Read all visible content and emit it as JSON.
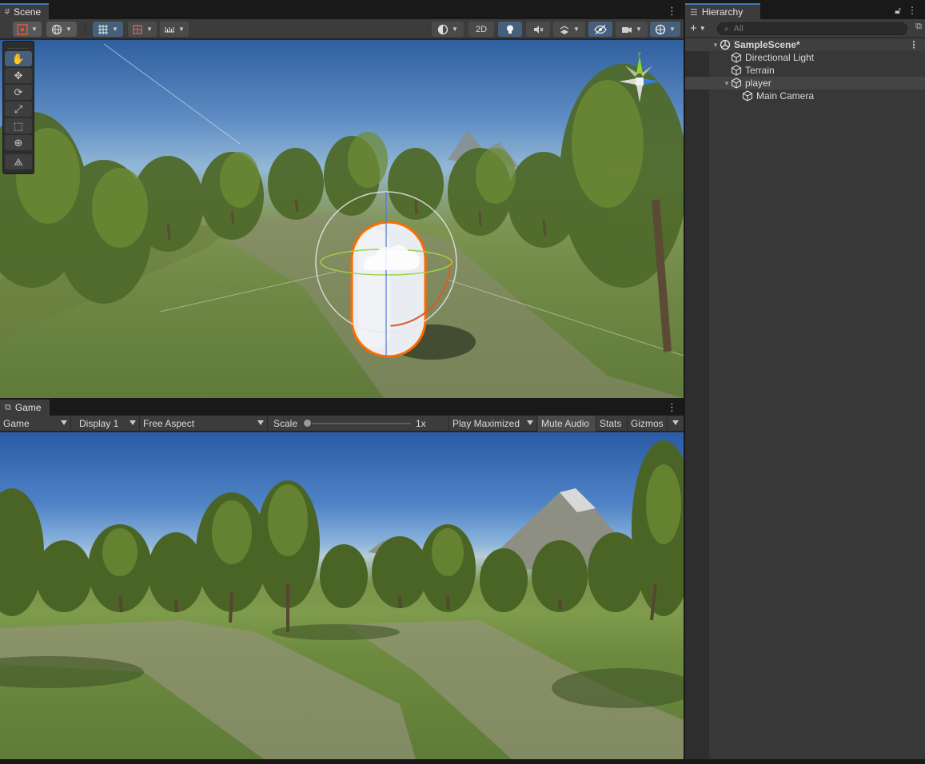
{
  "scene": {
    "tab_label": "Scene",
    "btn_2d": "2D",
    "persp_label": ""
  },
  "game": {
    "tab_label": "Game",
    "mode": "Game",
    "display": "Display 1",
    "aspect": "Free Aspect",
    "scale_label": "Scale",
    "scale_value": "1x",
    "play_maximized": "Play Maximized",
    "mute_audio": "Mute Audio",
    "stats": "Stats",
    "gizmos": "Gizmos"
  },
  "hierarchy": {
    "tab_label": "Hierarchy",
    "search_placeholder": "All",
    "items": [
      {
        "label": "SampleScene*"
      },
      {
        "label": "Directional Light"
      },
      {
        "label": "Terrain"
      },
      {
        "label": "player"
      },
      {
        "label": "Main Camera"
      }
    ]
  },
  "colors": {
    "accent": "#3a79bb",
    "selection_outline": "#ff6a00",
    "panel_bg": "#282828",
    "toolbar_bg": "#3c3c3c"
  }
}
